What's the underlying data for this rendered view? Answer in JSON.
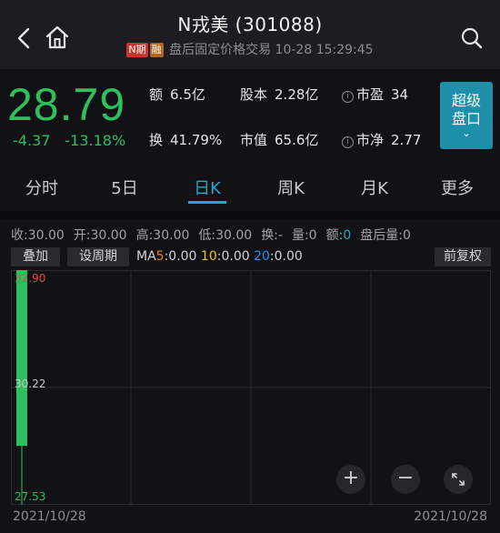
{
  "header": {
    "title": "N戎美 (301088)",
    "tag1": "N期",
    "tag2": "融",
    "subtitle": "盘后固定价格交易 10-28 15:29:45"
  },
  "quote": {
    "price": "28.79",
    "change": "-4.37",
    "change_pct": "-13.18%",
    "amount_label": "额",
    "amount": "6.5亿",
    "turnover_label": "换",
    "turnover": "41.79%",
    "share_label": "股本",
    "share": "2.28亿",
    "mktcap_label": "市值",
    "mktcap": "65.6亿",
    "pe_label": "市盈",
    "pe": "34",
    "pb_label": "市净",
    "pb": "2.77",
    "super_btn_l1": "超级",
    "super_btn_l2": "盘口",
    "colors": {
      "down": "#2fc05e",
      "up": "#e04b4b",
      "accent": "#1d8fa8"
    }
  },
  "tabs": [
    {
      "label": "分时"
    },
    {
      "label": "5日"
    },
    {
      "label": "日K"
    },
    {
      "label": "周K"
    },
    {
      "label": "月K"
    },
    {
      "label": "更多"
    }
  ],
  "active_tab": "日K",
  "kline_info": {
    "close": "收:30.00",
    "open": "开:30.00",
    "high": "高:30.00",
    "low": "低:30.00",
    "turn": "换:-",
    "vol": "量:0",
    "amt_label": "额:",
    "amt_value": "0",
    "after_vol": "盘后量:0"
  },
  "tools": {
    "overlay": "叠加",
    "period": "设周期",
    "ma_prefix": "MA",
    "ma5_n": "5",
    "ma5_v": ":0.00",
    "ma10_n": "10",
    "ma10_v": ":0.00",
    "ma20_n": "20",
    "ma20_v": ":0.00",
    "adjust": "前复权"
  },
  "chart": {
    "y_top": "32.90",
    "y_mid": "30.22",
    "y_bot": "27.53",
    "date_left": "2021/10/28",
    "date_right": "2021/10/28",
    "zoom_in": "+",
    "zoom_out": "−"
  },
  "chart_data": {
    "type": "candlestick",
    "x": [
      "2021/10/28"
    ],
    "candles": [
      {
        "date": "2021/10/28",
        "open": 33.16,
        "close": 28.79,
        "high": 33.16,
        "low": 28.79
      }
    ],
    "ylim": [
      27.53,
      32.9
    ],
    "grid": true
  }
}
